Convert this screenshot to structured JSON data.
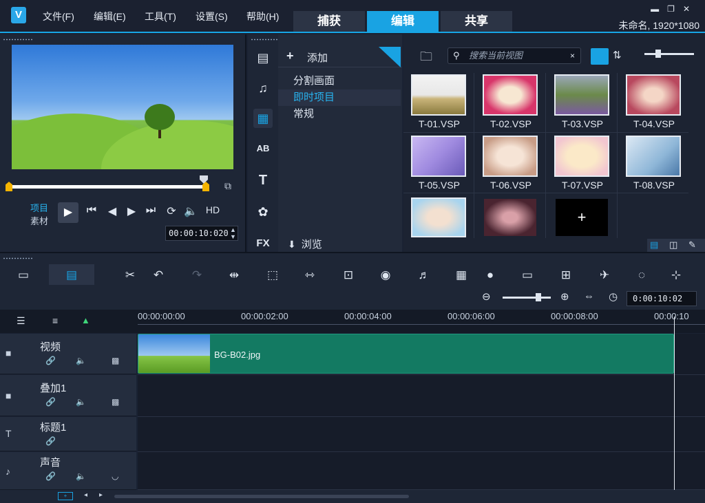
{
  "app": {
    "logo_text": "V",
    "project_info": "未命名, 1920*1080"
  },
  "menu": [
    "文件(F)",
    "编辑(E)",
    "工具(T)",
    "设置(S)",
    "帮助(H)"
  ],
  "tabs": [
    "捕获",
    "编辑",
    "共享"
  ],
  "active_tab": "编辑",
  "player": {
    "mode_project": "项目",
    "mode_clip": "素材",
    "quality": "HD",
    "timecode": "00:00:10:020"
  },
  "library": {
    "add_label": "添加",
    "items": [
      "分割画面",
      "即时项目",
      "常规"
    ],
    "selected_item": "即时项目",
    "browse_label": "浏览",
    "search_placeholder": "搜索当前视图",
    "side_icons": [
      "media-icon",
      "audio-icon",
      "instant-project-icon",
      "transition-icon",
      "title-icon",
      "graphics-icon",
      "fx-icon"
    ],
    "thumbnails": [
      "T-01.VSP",
      "T-02.VSP",
      "T-03.VSP",
      "T-04.VSP",
      "T-05.VSP",
      "T-06.VSP",
      "T-07.VSP",
      "T-08.VSP"
    ],
    "thumb_colors": [
      "#c9b47a",
      "#d8356a",
      "#7a5aa0",
      "#b8485e",
      "#a08be0",
      "#c89c86",
      "#f2c6d0",
      "#8fb7d8",
      "#a8d4ee",
      "#4a2430"
    ]
  },
  "timeline": {
    "zoom_timecode": "0:00:10:02",
    "ruler": [
      "00:00:00:00",
      "00:00:02:00",
      "00:00:04:00",
      "00:00:06:00",
      "00:00:08:00",
      "00:00:10"
    ],
    "tracks": [
      "视频",
      "叠加1",
      "标题1",
      "声音"
    ],
    "clip_name": "BG-B02.jpg"
  }
}
